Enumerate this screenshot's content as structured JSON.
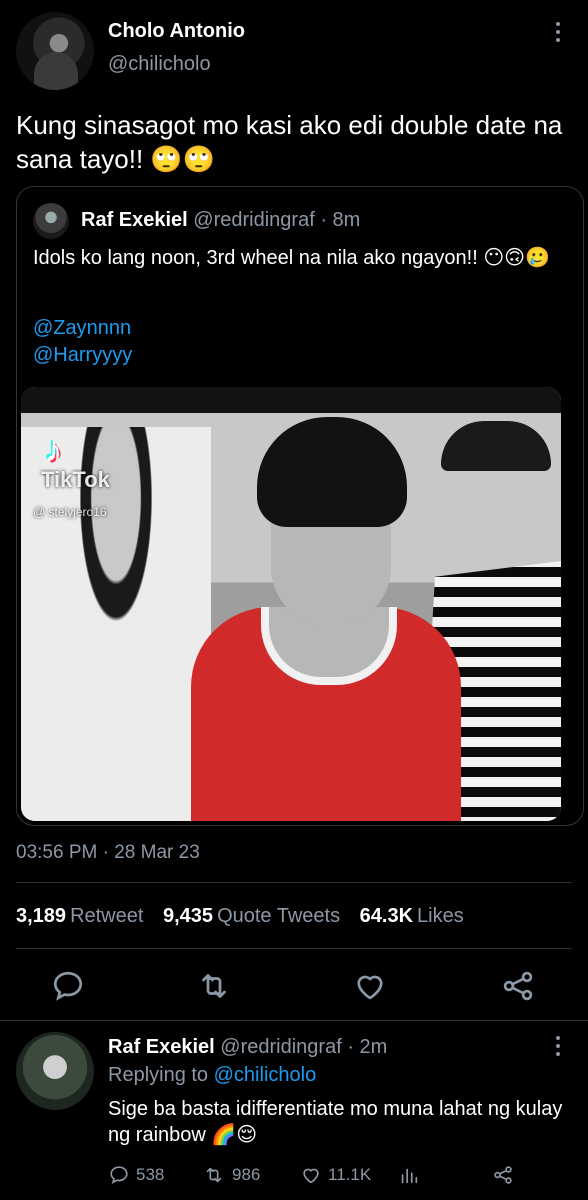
{
  "tweet": {
    "author_name": "Cholo Antonio",
    "author_handle": "@chilicholo",
    "text": "Kung sinasagot mo kasi ako edi double date na sana tayo!! 🙄🙄",
    "timestamp": "03:56 PM · 28 Mar 23",
    "stats": {
      "retweets_value": "3,189",
      "retweets_label": "Retweet",
      "quotes_value": "9,435",
      "quotes_label": "Quote Tweets",
      "likes_value": "64.3K",
      "likes_label": "Likes"
    }
  },
  "quoted": {
    "author_name": "Raf Exekiel",
    "author_handle": "@redridingraf",
    "time": "· 8m",
    "text": "Idols ko lang noon, 3rd wheel na nila ako ngayon!! 😶🙃🥲",
    "mention_1": "@Zaynnnn",
    "mention_2": "@Harryyyy",
    "media": {
      "watermark": "TikTok",
      "watermark_user": "@ stelyjero16"
    }
  },
  "actions": {
    "reply_icon": "comment-icon",
    "retweet_icon": "retweet-icon",
    "like_icon": "heart-icon",
    "share_icon": "share-icon"
  },
  "reply": {
    "author_name": "Raf Exekiel",
    "author_handle": "@redridingraf",
    "time": "· 2m",
    "replying_label": "Replying to",
    "replying_handle": "@chilicholo",
    "text": "Sige ba basta idifferentiate mo muna lahat ng kulay ng rainbow 🌈😌",
    "counts": {
      "replies": "538",
      "retweets": "986",
      "likes": "11.1K"
    }
  },
  "colors": {
    "background": "#000000",
    "link": "#1d9bf0",
    "muted": "#8b98a5",
    "divider": "#2f3336"
  }
}
